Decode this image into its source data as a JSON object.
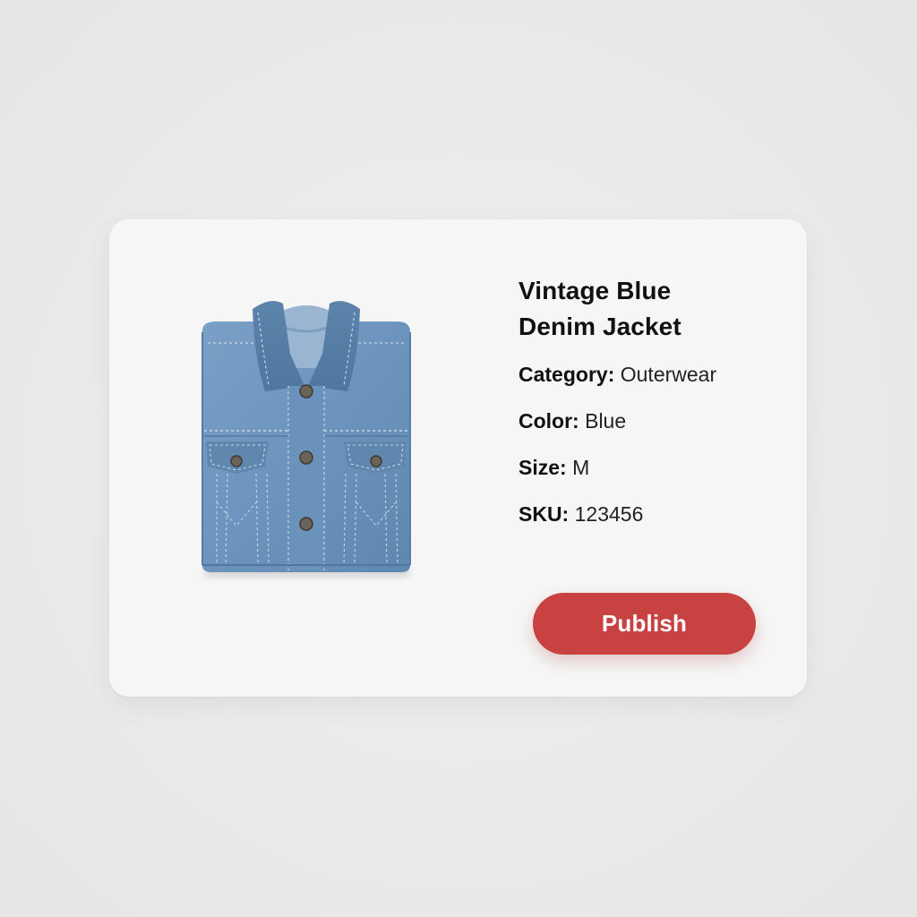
{
  "product": {
    "title_line1": "Vintage Blue",
    "title_line2": "Denim Jacket",
    "image_alt": "Folded blue denim jacket",
    "attributes": [
      {
        "key": "Category:",
        "value": " Outerwear"
      },
      {
        "key": "Color:",
        "value": " Blue"
      },
      {
        "key": "Size:",
        "value": " M"
      },
      {
        "key": "SKU:",
        "value": " 123456"
      }
    ]
  },
  "actions": {
    "publish_label": "Publish"
  },
  "colors": {
    "background": "#ececec",
    "card": "#f6f6f6",
    "accent": "#c94242",
    "denim": "#6f96bd"
  },
  "icons": {
    "product_image": "denim-jacket-icon"
  }
}
